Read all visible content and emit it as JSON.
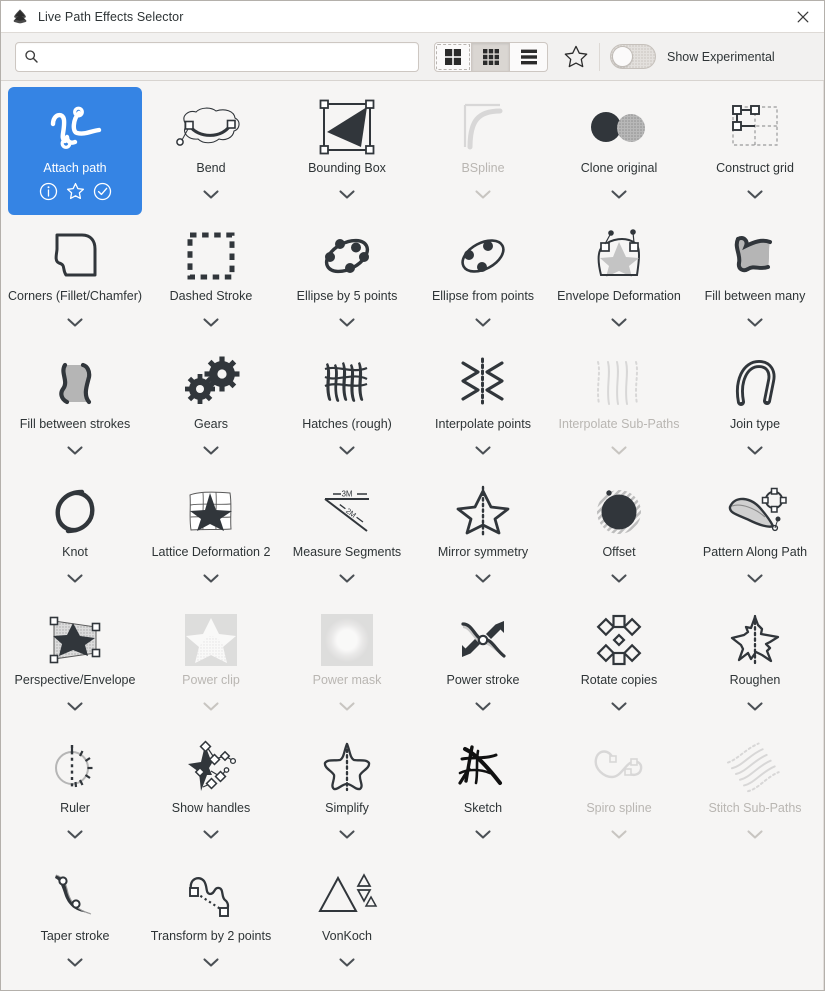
{
  "window": {
    "title": "Live Path Effects Selector",
    "app_icon": "inkscape-logo-icon",
    "close_label": "✕"
  },
  "toolbar": {
    "search": {
      "value": "",
      "placeholder": ""
    },
    "view_modes": [
      {
        "name": "large-grid-view",
        "label": "Large grid view",
        "active": false,
        "focused": true
      },
      {
        "name": "small-grid-view",
        "label": "Small grid view",
        "active": true,
        "focused": false
      },
      {
        "name": "list-view",
        "label": "List view",
        "active": false,
        "focused": false
      }
    ],
    "favorites_label": "Favorites",
    "experimental": {
      "label": "Show Experimental",
      "enabled": false
    }
  },
  "colors": {
    "selection_blue": "#3584e4",
    "window_bg": "#f6f5f4",
    "toolbar_bg": "#f2f1f0",
    "text": "#2e3436",
    "text_disabled": "#b9b6b2",
    "icon_dark": "#31363b",
    "icon_grey": "#b0b0b0"
  },
  "effects": [
    {
      "name": "Attach path",
      "selected": true,
      "disabled": false,
      "actions": [
        "info-icon",
        "star-icon",
        "apply-check-icon"
      ]
    },
    {
      "name": "Bend",
      "selected": false,
      "disabled": false
    },
    {
      "name": "Bounding Box",
      "selected": false,
      "disabled": false
    },
    {
      "name": "BSpline",
      "selected": false,
      "disabled": true
    },
    {
      "name": "Clone original",
      "selected": false,
      "disabled": false
    },
    {
      "name": "Construct grid",
      "selected": false,
      "disabled": false
    },
    {
      "name": "Corners (Fillet/Chamfer)",
      "selected": false,
      "disabled": false
    },
    {
      "name": "Dashed Stroke",
      "selected": false,
      "disabled": false
    },
    {
      "name": "Ellipse by 5 points",
      "selected": false,
      "disabled": false
    },
    {
      "name": "Ellipse from points",
      "selected": false,
      "disabled": false
    },
    {
      "name": "Envelope Deformation",
      "selected": false,
      "disabled": false
    },
    {
      "name": "Fill between many",
      "selected": false,
      "disabled": false
    },
    {
      "name": "Fill between strokes",
      "selected": false,
      "disabled": false
    },
    {
      "name": "Gears",
      "selected": false,
      "disabled": false
    },
    {
      "name": "Hatches (rough)",
      "selected": false,
      "disabled": false
    },
    {
      "name": "Interpolate points",
      "selected": false,
      "disabled": false
    },
    {
      "name": "Interpolate Sub-Paths",
      "selected": false,
      "disabled": true
    },
    {
      "name": "Join type",
      "selected": false,
      "disabled": false
    },
    {
      "name": "Knot",
      "selected": false,
      "disabled": false
    },
    {
      "name": "Lattice Deformation 2",
      "selected": false,
      "disabled": false
    },
    {
      "name": "Measure Segments",
      "selected": false,
      "disabled": false
    },
    {
      "name": "Mirror symmetry",
      "selected": false,
      "disabled": false
    },
    {
      "name": "Offset",
      "selected": false,
      "disabled": false
    },
    {
      "name": "Pattern Along Path",
      "selected": false,
      "disabled": false
    },
    {
      "name": "Perspective/Envelope",
      "selected": false,
      "disabled": false
    },
    {
      "name": "Power clip",
      "selected": false,
      "disabled": true
    },
    {
      "name": "Power mask",
      "selected": false,
      "disabled": true
    },
    {
      "name": "Power stroke",
      "selected": false,
      "disabled": false
    },
    {
      "name": "Rotate copies",
      "selected": false,
      "disabled": false
    },
    {
      "name": "Roughen",
      "selected": false,
      "disabled": false
    },
    {
      "name": "Ruler",
      "selected": false,
      "disabled": false
    },
    {
      "name": "Show handles",
      "selected": false,
      "disabled": false
    },
    {
      "name": "Simplify",
      "selected": false,
      "disabled": false
    },
    {
      "name": "Sketch",
      "selected": false,
      "disabled": false
    },
    {
      "name": "Spiro spline",
      "selected": false,
      "disabled": true
    },
    {
      "name": "Stitch Sub-Paths",
      "selected": false,
      "disabled": true
    },
    {
      "name": "Taper stroke",
      "selected": false,
      "disabled": false
    },
    {
      "name": "Transform by 2 points",
      "selected": false,
      "disabled": false
    },
    {
      "name": "VonKoch",
      "selected": false,
      "disabled": false
    }
  ],
  "measure_segments_labels": {
    "a": "3M",
    "b": "2M"
  }
}
